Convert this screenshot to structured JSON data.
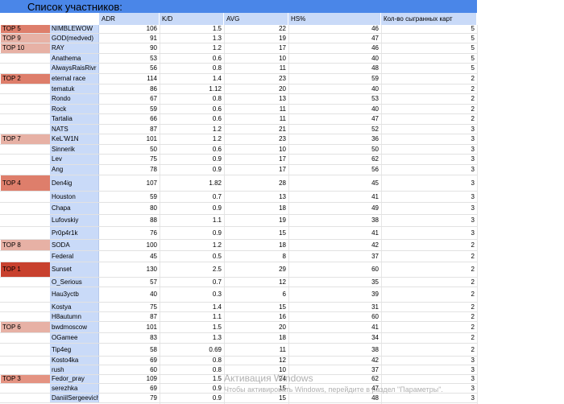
{
  "sheet": {
    "title": "Список участников:",
    "columns": {
      "adr": "ADR",
      "kd": "K/D",
      "avg": "AVG",
      "hs": "HS%",
      "maps": "Кол-во сыгранных карт"
    },
    "top_colors": {
      "TOP 1": "#c8412e",
      "TOP 2": "#de7e6b",
      "TOP 3": "#e49382",
      "TOP 4": "#de7e6b",
      "TOP 5": "#de7e6b",
      "TOP 6": "#e7b1a5",
      "TOP 7": "#e7b1a5",
      "TOP 8": "#e7b1a5",
      "TOP 9": "#e7b1a5",
      "TOP 10": "#e7b1a5"
    },
    "rows": [
      {
        "top": "TOP 5",
        "name": "NIMBLEWOW",
        "adr": "106",
        "kd": "1.5",
        "avg": "22",
        "hs": "46",
        "maps": "5"
      },
      {
        "top": "TOP 9",
        "name": "GOD(medved)",
        "adr": "91",
        "kd": "1.3",
        "avg": "19",
        "hs": "47",
        "maps": "5"
      },
      {
        "top": "TOP 10",
        "name": "RAY",
        "adr": "90",
        "kd": "1.2",
        "avg": "17",
        "hs": "46",
        "maps": "5"
      },
      {
        "top": "",
        "name": "Anathema",
        "adr": "53",
        "kd": "0.6",
        "avg": "10",
        "hs": "40",
        "maps": "5"
      },
      {
        "top": "",
        "name": "AlwaysRaisRivr",
        "adr": "56",
        "kd": "0.8",
        "avg": "11",
        "hs": "48",
        "maps": "5"
      },
      {
        "top": "TOP 2",
        "name": "eternal race",
        "adr": "114",
        "kd": "1.4",
        "avg": "23",
        "hs": "59",
        "maps": "2"
      },
      {
        "top": "",
        "name": "tematuk",
        "adr": "86",
        "kd": "1.12",
        "avg": "20",
        "hs": "40",
        "maps": "2"
      },
      {
        "top": "",
        "name": "Rondo",
        "adr": "67",
        "kd": "0.8",
        "avg": "13",
        "hs": "53",
        "maps": "2"
      },
      {
        "top": "",
        "name": "Rock",
        "adr": "59",
        "kd": "0.6",
        "avg": "11",
        "hs": "40",
        "maps": "2"
      },
      {
        "top": "",
        "name": "Tartalia",
        "adr": "66",
        "kd": "0.6",
        "avg": "11",
        "hs": "47",
        "maps": "2"
      },
      {
        "top": "",
        "name": "NATS",
        "adr": "87",
        "kd": "1.2",
        "avg": "21",
        "hs": "52",
        "maps": "3"
      },
      {
        "top": "TOP 7",
        "name": "KeL'W1N",
        "adr": "101",
        "kd": "1.2",
        "avg": "23",
        "hs": "36",
        "maps": "3"
      },
      {
        "top": "",
        "name": "Sinnerik",
        "adr": "50",
        "kd": "0.6",
        "avg": "10",
        "hs": "50",
        "maps": "3"
      },
      {
        "top": "",
        "name": "Lev",
        "adr": "75",
        "kd": "0.9",
        "avg": "17",
        "hs": "62",
        "maps": "3"
      },
      {
        "top": "",
        "name": "Ang",
        "adr": "78",
        "kd": "0.9",
        "avg": "17",
        "hs": "56",
        "maps": "3"
      },
      {
        "top": "TOP 4",
        "name": "Den4ig",
        "adr": "107",
        "kd": "1.82",
        "avg": "28",
        "hs": "45",
        "maps": "3"
      },
      {
        "top": "",
        "name": "Houston",
        "adr": "59",
        "kd": "0.7",
        "avg": "13",
        "hs": "41",
        "maps": "3"
      },
      {
        "top": "",
        "name": "Chapa",
        "adr": "80",
        "kd": "0.9",
        "avg": "18",
        "hs": "49",
        "maps": "3"
      },
      {
        "top": "",
        "name": "Lufovskiy",
        "adr": "88",
        "kd": "1.1",
        "avg": "19",
        "hs": "38",
        "maps": "3"
      },
      {
        "top": "",
        "name": "Pr0p4r1k",
        "adr": "76",
        "kd": "0.9",
        "avg": "15",
        "hs": "41",
        "maps": "3"
      },
      {
        "top": "TOP 8",
        "name": "SODA",
        "adr": "100",
        "kd": "1.2",
        "avg": "18",
        "hs": "42",
        "maps": "2"
      },
      {
        "top": "",
        "name": "Federal",
        "adr": "45",
        "kd": "0.5",
        "avg": "8",
        "hs": "37",
        "maps": "2"
      },
      {
        "top": "TOP 1",
        "name": "Sunset",
        "adr": "130",
        "kd": "2.5",
        "avg": "29",
        "hs": "60",
        "maps": "2"
      },
      {
        "top": "",
        "name": "O_Serious",
        "adr": "57",
        "kd": "0.7",
        "avg": "12",
        "hs": "35",
        "maps": "2"
      },
      {
        "top": "",
        "name": "Hau3yctb",
        "adr": "40",
        "kd": "0.3",
        "avg": "6",
        "hs": "39",
        "maps": "2"
      },
      {
        "top": "",
        "name": "Kostya",
        "adr": "75",
        "kd": "1.4",
        "avg": "15",
        "hs": "31",
        "maps": "2"
      },
      {
        "top": "",
        "name": "H8autumn",
        "adr": "87",
        "kd": "1.1",
        "avg": "16",
        "hs": "60",
        "maps": "2"
      },
      {
        "top": "TOP 6",
        "name": "bwdmoscow",
        "adr": "101",
        "kd": "1.5",
        "avg": "20",
        "hs": "41",
        "maps": "2"
      },
      {
        "top": "",
        "name": "OGamee",
        "adr": "83",
        "kd": "1.3",
        "avg": "18",
        "hs": "34",
        "maps": "2"
      },
      {
        "top": "",
        "name": "Tip4eg",
        "adr": "58",
        "kd": "0.69",
        "avg": "11",
        "hs": "38",
        "maps": "2"
      },
      {
        "top": "",
        "name": "Kosto4ka",
        "adr": "69",
        "kd": "0.8",
        "avg": "12",
        "hs": "42",
        "maps": "3"
      },
      {
        "top": "",
        "name": "rush",
        "adr": "60",
        "kd": "0.8",
        "avg": "10",
        "hs": "37",
        "maps": "3"
      },
      {
        "top": "TOP 3",
        "name": "Fedor_pray",
        "adr": "109",
        "kd": "1.5",
        "avg": "24",
        "hs": "62",
        "maps": "3"
      },
      {
        "top": "",
        "name": "serezhka",
        "adr": "69",
        "kd": "0.9",
        "avg": "15",
        "hs": "47",
        "maps": "3"
      },
      {
        "top": "",
        "name": "DaniilSergeevich",
        "adr": "79",
        "kd": "0.9",
        "avg": "15",
        "hs": "48",
        "maps": "3"
      }
    ]
  },
  "watermark": {
    "line1": "Активация Windows",
    "line2": "Чтобы активировать Windows, перейдите в раздел \"Параметры\"."
  }
}
